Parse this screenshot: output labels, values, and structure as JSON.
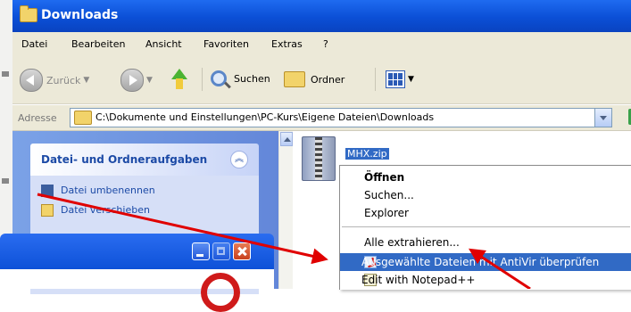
{
  "window": {
    "title": "Downloads"
  },
  "menubar": {
    "items": [
      "Datei",
      "Bearbeiten",
      "Ansicht",
      "Favoriten",
      "Extras",
      "?"
    ]
  },
  "toolbar": {
    "back_label": "Zurück",
    "search_label": "Suchen",
    "folders_label": "Ordner"
  },
  "address": {
    "label": "Adresse",
    "path": "C:\\Dokumente und Einstellungen\\PC-Kurs\\Eigene Dateien\\Downloads"
  },
  "taskpane": {
    "title": "Datei- und Ordneraufgaben",
    "links": [
      "Datei umbenennen",
      "Datei verschieben"
    ]
  },
  "file": {
    "name": "MHX.zip"
  },
  "context_menu": {
    "open": "Öffnen",
    "search": "Suchen...",
    "explorer": "Explorer",
    "extract_all": "Alle extrahieren...",
    "antivir": "Ausgewählte Dateien mit AntiVir überprüfen",
    "notepad": "Edit with Notepad++"
  },
  "colors": {
    "title_bar": "#0b4fd6",
    "selection": "#316ac5",
    "annotation_arrow": "#e00000"
  }
}
